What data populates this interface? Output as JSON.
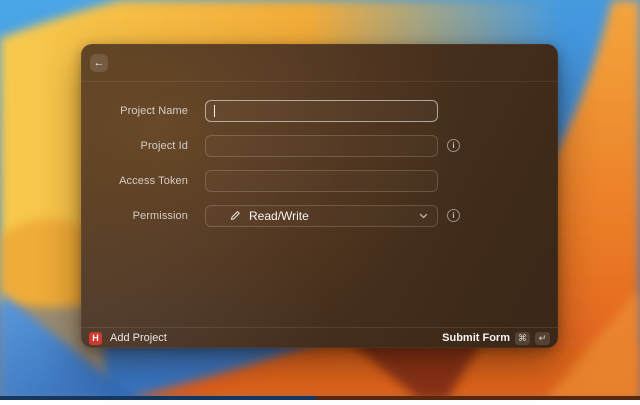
{
  "header": {
    "back_label": "←"
  },
  "form": {
    "info_glyph": "i",
    "fields": [
      {
        "label": "Project Name",
        "value": "",
        "type": "text",
        "focused": true,
        "has_info": false
      },
      {
        "label": "Project Id",
        "value": "",
        "type": "text",
        "focused": false,
        "has_info": true
      },
      {
        "label": "Access Token",
        "value": "",
        "type": "text",
        "focused": false,
        "has_info": false
      },
      {
        "label": "Permission",
        "value": "Read/Write",
        "type": "dropdown",
        "focused": false,
        "has_info": true
      }
    ]
  },
  "footer": {
    "app_icon_letter": "H",
    "app_name": "Add Project",
    "submit_label": "Submit Form",
    "shortcut_keys": [
      "⌘",
      "↵"
    ]
  },
  "colors": {
    "logo_red": "#d23730",
    "window_brown": "#4b3220",
    "sky_blue": "#4aa7e8",
    "deep_blue": "#3674c4",
    "dune_gold": "#f2ab38",
    "dune_orange": "#ea7a26"
  }
}
